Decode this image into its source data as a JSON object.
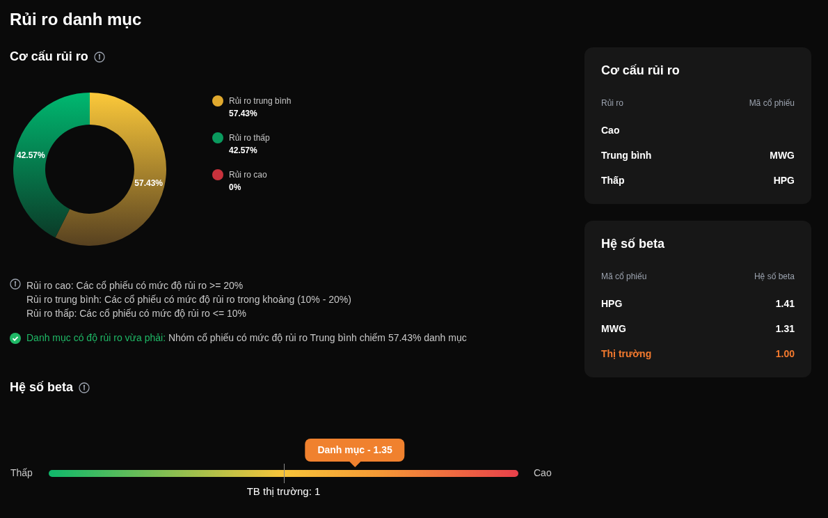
{
  "page": {
    "title": "Rủi ro danh mục"
  },
  "risk_structure": {
    "title": "Cơ cấu rủi ro",
    "chart_data": {
      "type": "donut",
      "categories": [
        "Rủi ro trung bình",
        "Rủi ro thấp",
        "Rủi ro cao"
      ],
      "values": [
        57.43,
        42.57,
        0
      ],
      "value_labels": [
        "57.43%",
        "42.57%",
        null
      ]
    },
    "legend": [
      {
        "value": "57.43%",
        "color": "#e0a92e"
      },
      {
        "value": "42.57%",
        "color": "#0a9a5e"
      },
      {
        "value": "0%",
        "color": "#c8323c"
      }
    ],
    "notes": [
      "Rủi ro cao: Các cổ phiếu có mức độ rủi ro >= 20%",
      "Rủi ro trung bình: Các cổ phiếu có mức độ rủi ro trong khoảng (10% - 20%)",
      "Rủi ro thấp: Các cổ phiếu có mức độ rủi ro <= 10%"
    ],
    "assessment": {
      "kind": "ok",
      "highlight": "Danh mục có độ rủi ro vừa phải:",
      "text": "Nhóm cổ phiếu có mức độ rủi ro Trung bình chiếm 57.43% danh mục"
    }
  },
  "beta": {
    "title": "Hệ số beta",
    "low_label": "Thấp",
    "high_label": "Cao",
    "portfolio": {
      "label": "Danh mục - 1.35",
      "level": 0.652
    },
    "market": {
      "label": "TB thị trường: 1",
      "level": 0.5
    }
  },
  "risk_table": {
    "title": "Cơ cấu rủi ro",
    "columns": [
      "Rủi ro",
      "Mã cổ phiếu"
    ],
    "rows": [
      {
        "risk": "Cao"
      },
      {
        "risk": "Trung bình",
        "ticker": "MWG"
      },
      {
        "risk": "Thấp",
        "ticker": "HPG"
      }
    ]
  },
  "beta_table": {
    "title": "Hệ số beta",
    "columns": [
      "Mã cổ phiếu",
      "Hệ số beta"
    ],
    "rows": [
      {
        "ticker": "HPG",
        "beta": "1.41",
        "highlighted": false
      },
      {
        "ticker": "MWG",
        "beta": "1.31",
        "highlighted": false
      },
      {
        "ticker": "Thị trường",
        "beta": "1.00",
        "highlighted": true
      }
    ]
  }
}
